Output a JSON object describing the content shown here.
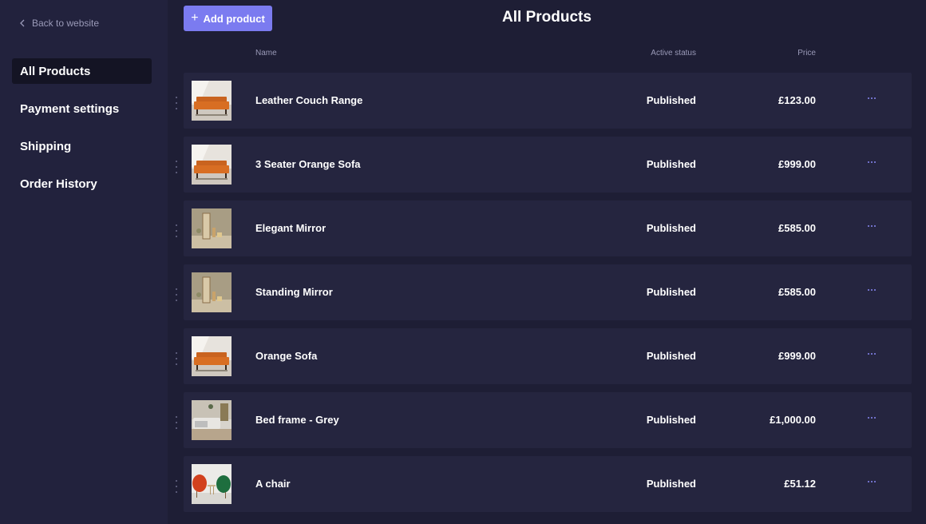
{
  "sidebar": {
    "back_label": "Back to website",
    "items": [
      {
        "label": "All Products",
        "active": true
      },
      {
        "label": "Payment settings",
        "active": false
      },
      {
        "label": "Shipping",
        "active": false
      },
      {
        "label": "Order History",
        "active": false
      }
    ]
  },
  "header": {
    "add_button_label": "Add product",
    "title": "All Products"
  },
  "table": {
    "columns": {
      "name": "Name",
      "status": "Active status",
      "price": "Price"
    },
    "rows": [
      {
        "name": "Leather Couch Range",
        "status": "Published",
        "price": "£123.00",
        "image": "orange-sofa"
      },
      {
        "name": "3 Seater Orange Sofa",
        "status": "Published",
        "price": "£999.00",
        "image": "orange-sofa"
      },
      {
        "name": "Elegant Mirror",
        "status": "Published",
        "price": "£585.00",
        "image": "mirror"
      },
      {
        "name": "Standing Mirror",
        "status": "Published",
        "price": "£585.00",
        "image": "mirror"
      },
      {
        "name": "Orange Sofa",
        "status": "Published",
        "price": "£999.00",
        "image": "orange-sofa"
      },
      {
        "name": "Bed frame - Grey",
        "status": "Published",
        "price": "£1,000.00",
        "image": "bed"
      },
      {
        "name": "A chair",
        "status": "Published",
        "price": "£51.12",
        "image": "chairs"
      }
    ]
  },
  "colors": {
    "background": "#1e1e35",
    "sidebar": "#22223d",
    "card": "#25253f",
    "accent": "#7b7bf0",
    "muted_text": "#9a9ab8"
  }
}
